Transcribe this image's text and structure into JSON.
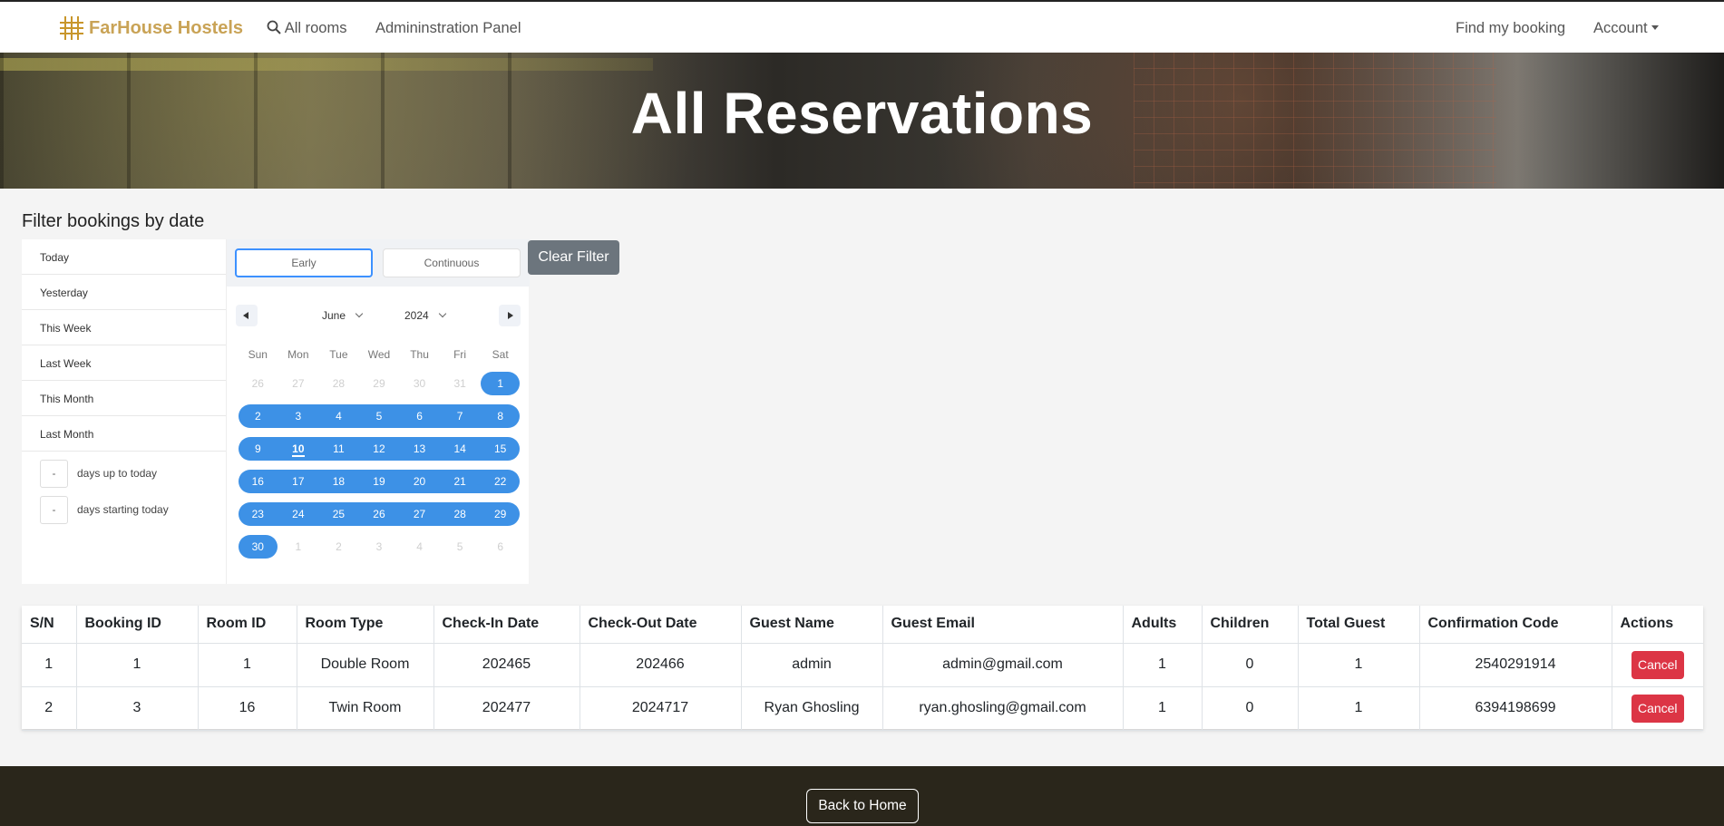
{
  "nav": {
    "brand": "FarHouse Hostels",
    "all_rooms": "All rooms",
    "admin_panel": "Admininstration Panel",
    "find_booking": "Find my booking",
    "account": "Account"
  },
  "hero": {
    "title": "All Reservations"
  },
  "filter": {
    "heading": "Filter bookings by date",
    "ranges": [
      "Today",
      "Yesterday",
      "This Week",
      "Last Week",
      "This Month",
      "Last Month"
    ],
    "days_up_to_today": {
      "value": "-",
      "label": "days up to today"
    },
    "days_starting_today": {
      "value": "-",
      "label": "days starting today"
    },
    "tab_early": "Early",
    "tab_continuous": "Continuous",
    "month": "June",
    "year": "2024",
    "weekdays": [
      "Sun",
      "Mon",
      "Tue",
      "Wed",
      "Thu",
      "Fri",
      "Sat"
    ],
    "weeks": [
      [
        "26",
        "27",
        "28",
        "29",
        "30",
        "31",
        "1"
      ],
      [
        "2",
        "3",
        "4",
        "5",
        "6",
        "7",
        "8"
      ],
      [
        "9",
        "10",
        "11",
        "12",
        "13",
        "14",
        "15"
      ],
      [
        "16",
        "17",
        "18",
        "19",
        "20",
        "21",
        "22"
      ],
      [
        "23",
        "24",
        "25",
        "26",
        "27",
        "28",
        "29"
      ],
      [
        "30",
        "1",
        "2",
        "3",
        "4",
        "5",
        "6"
      ]
    ],
    "today": "10",
    "clear_label": "Clear Filter"
  },
  "table": {
    "headers": [
      "S/N",
      "Booking ID",
      "Room ID",
      "Room Type",
      "Check-In Date",
      "Check-Out Date",
      "Guest Name",
      "Guest Email",
      "Adults",
      "Children",
      "Total Guest",
      "Confirmation Code",
      "Actions"
    ],
    "rows": [
      {
        "sn": "1",
        "booking_id": "1",
        "room_id": "1",
        "room_type": "Double Room",
        "check_in": "202465",
        "check_out": "202466",
        "guest_name": "admin",
        "guest_email": "admin@gmail.com",
        "adults": "1",
        "children": "0",
        "total": "1",
        "code": "2540291914",
        "action": "Cancel"
      },
      {
        "sn": "2",
        "booking_id": "3",
        "room_id": "16",
        "room_type": "Twin Room",
        "check_in": "202477",
        "check_out": "2024717",
        "guest_name": "Ryan Ghosling",
        "guest_email": "ryan.ghosling@gmail.com",
        "adults": "1",
        "children": "0",
        "total": "1",
        "code": "6394198699",
        "action": "Cancel"
      }
    ]
  },
  "footer": {
    "home_label": "Back to Home"
  },
  "colors": {
    "accent": "#3d91e6",
    "danger": "#dc3545",
    "brand": "#c9a356",
    "footer": "#2a261b"
  }
}
